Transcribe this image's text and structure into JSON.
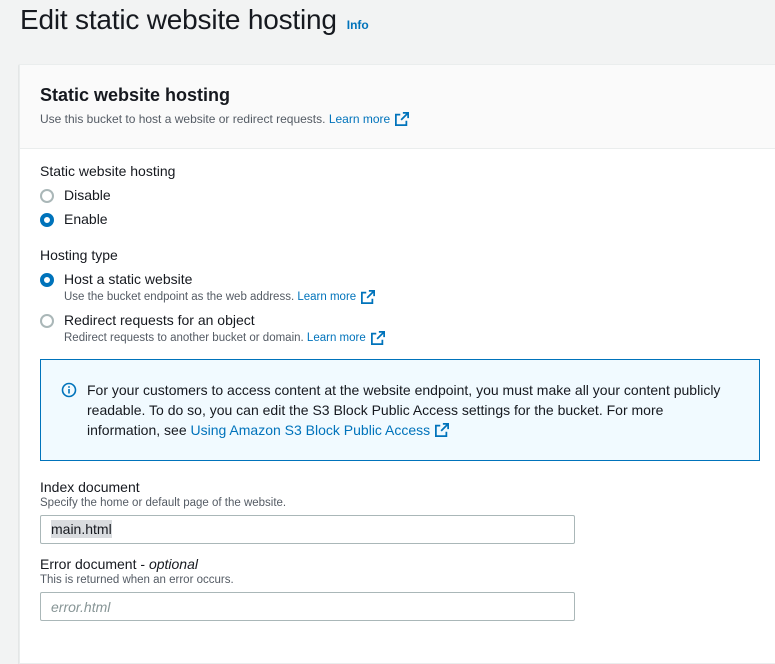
{
  "header": {
    "title": "Edit static website hosting",
    "info": "Info"
  },
  "panel": {
    "title": "Static website hosting",
    "desc": "Use this bucket to host a website or redirect requests.",
    "learn_more": "Learn more"
  },
  "hosting": {
    "label": "Static website hosting",
    "options": [
      {
        "label": "Disable",
        "checked": false
      },
      {
        "label": "Enable",
        "checked": true
      }
    ]
  },
  "hosting_type": {
    "label": "Hosting type",
    "options": [
      {
        "label": "Host a static website",
        "desc": "Use the bucket endpoint as the web address.",
        "learn_more": "Learn more",
        "checked": true
      },
      {
        "label": "Redirect requests for an object",
        "desc": "Redirect requests to another bucket or domain.",
        "learn_more": "Learn more",
        "checked": false
      }
    ]
  },
  "alert": {
    "text": "For your customers to access content at the website endpoint, you must make all your content publicly readable. To do so, you can edit the S3 Block Public Access settings for the bucket. For more information, see ",
    "link": "Using Amazon S3 Block Public Access"
  },
  "index_document": {
    "label": "Index document",
    "desc": "Specify the home or default page of the website.",
    "value": "main.html"
  },
  "error_document": {
    "label": "Error document - ",
    "optional": "optional",
    "desc": "This is returned when an error occurs.",
    "placeholder": "error.html",
    "value": ""
  },
  "colors": {
    "accent": "#0073bb",
    "alert_bg": "#f1faff"
  }
}
